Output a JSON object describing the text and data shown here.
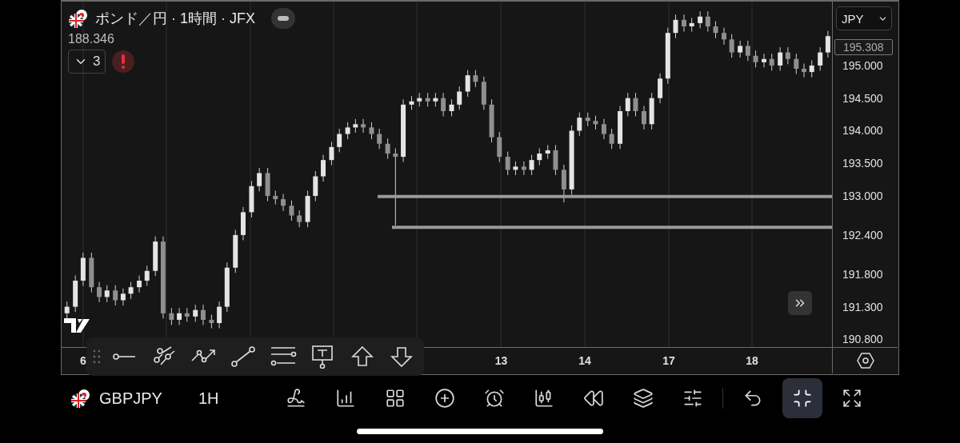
{
  "chart_header": {
    "title": "ポンド／円 · 1時間 · JFX",
    "price": "188.346",
    "indicator_count": "3",
    "indicators_expanded": false
  },
  "currency_select": "JPY",
  "current_price": "195.308",
  "chart": {
    "chart_data": {
      "type": "candlestick",
      "ylim": [
        190.67,
        195.98
      ],
      "yticks": [
        {
          "value": 195.0,
          "label": "195.000"
        },
        {
          "value": 194.5,
          "label": "194.500"
        },
        {
          "value": 194.0,
          "label": "194.000"
        },
        {
          "value": 193.5,
          "label": "193.500"
        },
        {
          "value": 193.0,
          "label": "193.000"
        },
        {
          "value": 192.4,
          "label": "192.400"
        },
        {
          "value": 191.8,
          "label": "191.800"
        },
        {
          "value": 191.3,
          "label": "191.300"
        },
        {
          "value": 190.8,
          "label": "190.800"
        }
      ],
      "xlim": [
        5.64,
        19.65
      ],
      "xticks": [
        6,
        13
      ],
      "x": [
        5.73,
        5.87,
        6.0,
        6.14,
        6.27,
        6.4,
        6.54,
        6.67,
        6.8,
        6.94,
        7.07,
        7.21,
        7.34,
        7.48,
        7.61,
        7.74,
        7.88,
        8.01,
        8.15,
        8.28,
        8.41,
        8.55,
        8.68,
        8.82,
        8.95,
        9.09,
        9.22,
        9.35,
        9.49,
        9.62,
        9.76,
        9.89,
        10.02,
        10.16,
        10.29,
        10.43,
        10.56,
        10.69,
        10.83,
        10.96,
        11.1,
        11.23,
        11.36,
        11.5,
        11.63,
        11.77,
        11.9,
        12.03,
        12.17,
        12.3,
        12.44,
        12.57,
        12.71,
        12.84,
        12.97,
        13.11,
        13.24,
        13.38,
        13.51,
        13.64,
        13.78,
        13.91,
        14.05,
        14.18,
        14.31,
        14.45,
        14.58,
        14.72,
        14.85,
        14.99,
        15.12,
        15.25,
        15.39,
        15.52,
        15.66,
        15.79,
        15.92,
        16.06,
        16.19,
        16.33,
        16.46,
        16.59,
        16.73,
        16.86,
        17.0,
        17.13,
        17.26,
        17.4,
        17.53,
        17.67,
        17.8,
        17.94,
        18.07,
        18.2,
        18.34,
        18.47
      ],
      "ohlc": [
        [
          191.2,
          191.38,
          191.12,
          191.3
        ],
        [
          191.3,
          191.78,
          191.22,
          191.7
        ],
        [
          191.7,
          192.13,
          191.62,
          192.05
        ],
        [
          192.05,
          192.13,
          191.52,
          191.6
        ],
        [
          191.6,
          191.68,
          191.37,
          191.45
        ],
        [
          191.45,
          191.63,
          191.37,
          191.55
        ],
        [
          191.55,
          191.63,
          191.32,
          191.4
        ],
        [
          191.4,
          191.58,
          191.32,
          191.5
        ],
        [
          191.5,
          191.68,
          191.42,
          191.6
        ],
        [
          191.6,
          191.78,
          191.52,
          191.7
        ],
        [
          191.7,
          191.93,
          191.62,
          191.85
        ],
        [
          191.85,
          192.38,
          191.77,
          192.3
        ],
        [
          192.3,
          192.38,
          191.12,
          191.2
        ],
        [
          191.2,
          191.28,
          191.02,
          191.1
        ],
        [
          191.1,
          191.28,
          191.02,
          191.2
        ],
        [
          191.2,
          191.28,
          191.07,
          191.15
        ],
        [
          191.15,
          191.33,
          191.07,
          191.25
        ],
        [
          191.25,
          191.33,
          191.02,
          191.1
        ],
        [
          191.1,
          191.18,
          190.97,
          191.05
        ],
        [
          191.05,
          191.38,
          190.97,
          191.3
        ],
        [
          191.3,
          191.98,
          191.22,
          191.9
        ],
        [
          191.9,
          192.48,
          191.82,
          192.4
        ],
        [
          192.4,
          192.83,
          192.32,
          192.75
        ],
        [
          192.75,
          193.23,
          192.67,
          193.15
        ],
        [
          193.15,
          193.43,
          193.07,
          193.35
        ],
        [
          193.35,
          193.43,
          192.92,
          193.0
        ],
        [
          193.0,
          193.08,
          192.87,
          192.95
        ],
        [
          192.95,
          193.03,
          192.77,
          192.85
        ],
        [
          192.85,
          192.93,
          192.62,
          192.7
        ],
        [
          192.7,
          192.78,
          192.52,
          192.6
        ],
        [
          192.6,
          193.08,
          192.52,
          193.0
        ],
        [
          193.0,
          193.38,
          192.92,
          193.3
        ],
        [
          193.3,
          193.63,
          193.22,
          193.55
        ],
        [
          193.55,
          193.83,
          193.47,
          193.75
        ],
        [
          193.75,
          194.03,
          193.67,
          193.95
        ],
        [
          193.95,
          194.13,
          193.87,
          194.05
        ],
        [
          194.05,
          194.18,
          193.97,
          194.1
        ],
        [
          194.1,
          194.18,
          193.97,
          194.05
        ],
        [
          194.05,
          194.13,
          193.87,
          193.95
        ],
        [
          193.95,
          194.03,
          193.72,
          193.8
        ],
        [
          193.8,
          193.88,
          193.57,
          193.65
        ],
        [
          193.65,
          193.73,
          192.55,
          193.6
        ],
        [
          193.6,
          194.48,
          193.52,
          194.4
        ],
        [
          194.4,
          194.53,
          194.32,
          194.45
        ],
        [
          194.45,
          194.58,
          194.37,
          194.5
        ],
        [
          194.5,
          194.58,
          194.37,
          194.45
        ],
        [
          194.45,
          194.58,
          194.37,
          194.5
        ],
        [
          194.5,
          194.58,
          194.22,
          194.3
        ],
        [
          194.3,
          194.48,
          194.22,
          194.4
        ],
        [
          194.4,
          194.68,
          194.32,
          194.6
        ],
        [
          194.6,
          194.93,
          194.52,
          194.85
        ],
        [
          194.85,
          194.93,
          194.67,
          194.75
        ],
        [
          194.75,
          194.83,
          194.32,
          194.4
        ],
        [
          194.4,
          194.48,
          193.82,
          193.9
        ],
        [
          193.9,
          193.98,
          193.52,
          193.6
        ],
        [
          193.6,
          193.68,
          193.32,
          193.4
        ],
        [
          193.4,
          193.53,
          193.32,
          193.45
        ],
        [
          193.45,
          193.53,
          193.32,
          193.4
        ],
        [
          193.4,
          193.63,
          193.32,
          193.55
        ],
        [
          193.55,
          193.73,
          193.47,
          193.65
        ],
        [
          193.65,
          193.78,
          193.57,
          193.7
        ],
        [
          193.7,
          193.78,
          193.32,
          193.4
        ],
        [
          193.4,
          193.48,
          192.9,
          193.1
        ],
        [
          193.1,
          194.08,
          193.02,
          194.0
        ],
        [
          194.0,
          194.28,
          193.92,
          194.2
        ],
        [
          194.2,
          194.28,
          194.07,
          194.15
        ],
        [
          194.15,
          194.23,
          194.02,
          194.1
        ],
        [
          194.1,
          194.18,
          193.87,
          193.95
        ],
        [
          193.95,
          194.03,
          193.72,
          193.8
        ],
        [
          193.8,
          194.38,
          193.72,
          194.3
        ],
        [
          194.3,
          194.58,
          194.22,
          194.5
        ],
        [
          194.5,
          194.58,
          194.22,
          194.3
        ],
        [
          194.3,
          194.38,
          194.02,
          194.1
        ],
        [
          194.1,
          194.58,
          194.02,
          194.5
        ],
        [
          194.5,
          194.88,
          194.42,
          194.8
        ],
        [
          194.8,
          195.58,
          194.72,
          195.5
        ],
        [
          195.5,
          195.78,
          195.42,
          195.7
        ],
        [
          195.7,
          195.78,
          195.52,
          195.6
        ],
        [
          195.6,
          195.73,
          195.52,
          195.65
        ],
        [
          195.65,
          195.83,
          195.57,
          195.75
        ],
        [
          195.75,
          195.83,
          195.52,
          195.6
        ],
        [
          195.6,
          195.68,
          195.42,
          195.5
        ],
        [
          195.5,
          195.58,
          195.32,
          195.4
        ],
        [
          195.4,
          195.48,
          195.12,
          195.2
        ],
        [
          195.2,
          195.38,
          195.12,
          195.3
        ],
        [
          195.3,
          195.38,
          195.07,
          195.15
        ],
        [
          195.15,
          195.23,
          194.97,
          195.05
        ],
        [
          195.05,
          195.18,
          194.97,
          195.1
        ],
        [
          195.1,
          195.18,
          194.92,
          195.0
        ],
        [
          195.0,
          195.28,
          194.92,
          195.2
        ],
        [
          195.2,
          195.28,
          195.02,
          195.1
        ],
        [
          195.1,
          195.18,
          194.87,
          194.95
        ],
        [
          194.95,
          195.03,
          194.82,
          194.9
        ],
        [
          194.9,
          195.08,
          194.82,
          195.0
        ],
        [
          195.0,
          195.28,
          194.92,
          195.2
        ],
        [
          195.2,
          195.53,
          195.12,
          195.45
        ]
      ],
      "ref_lines": [
        {
          "axis": "y",
          "value": 192.99
        },
        {
          "axis": "y",
          "value": 192.52
        }
      ]
    }
  },
  "time_axis": {
    "labels": [
      "6",
      "13",
      "14",
      "17",
      "18"
    ]
  },
  "bottom_bar": {
    "symbol": "GBPJPY",
    "interval": "1H",
    "tools": [
      {
        "kind": "draw",
        "selected": false
      },
      {
        "kind": "indicators",
        "selected": false
      },
      {
        "kind": "layouts",
        "selected": false
      },
      {
        "kind": "add",
        "selected": false
      },
      {
        "kind": "alert",
        "selected": false
      },
      {
        "kind": "chart_type",
        "selected": false
      },
      {
        "kind": "replay",
        "selected": false
      },
      {
        "kind": "layers",
        "selected": false
      },
      {
        "kind": "settings",
        "selected": false
      },
      {
        "kind": "undo",
        "selected": false
      },
      {
        "kind": "exit_fullscreen",
        "selected": true
      },
      {
        "kind": "fullscreen",
        "selected": false
      }
    ]
  }
}
